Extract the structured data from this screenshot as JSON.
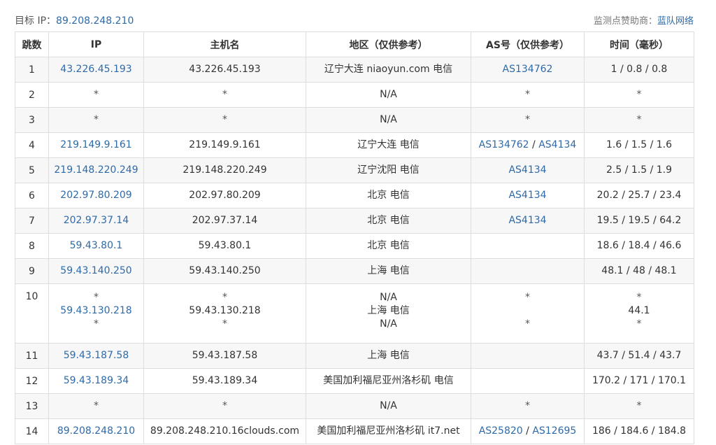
{
  "header": {
    "target_label": "目标 IP：",
    "target_ip": "89.208.248.210",
    "sponsor_label": "监测点赞助商：",
    "sponsor_name": "蓝队网络"
  },
  "table": {
    "columns": [
      "跳数",
      "IP",
      "主机名",
      "地区（仅供参考）",
      "AS号（仅供参考）",
      "时间（毫秒）"
    ],
    "rows": [
      {
        "hop": "1",
        "ip": [
          "43.226.45.193"
        ],
        "host": [
          "43.226.45.193"
        ],
        "region": [
          "辽宁大连 niaoyun.com 电信"
        ],
        "as": [
          [
            "AS134762"
          ]
        ],
        "time": [
          "1 / 0.8 / 0.8"
        ]
      },
      {
        "hop": "2",
        "ip": [
          "*"
        ],
        "host": [
          "*"
        ],
        "region": [
          "N/A"
        ],
        "as": [
          [
            "*"
          ]
        ],
        "time": [
          "*"
        ]
      },
      {
        "hop": "3",
        "ip": [
          "*"
        ],
        "host": [
          "*"
        ],
        "region": [
          "N/A"
        ],
        "as": [
          [
            "*"
          ]
        ],
        "time": [
          "*"
        ]
      },
      {
        "hop": "4",
        "ip": [
          "219.149.9.161"
        ],
        "host": [
          "219.149.9.161"
        ],
        "region": [
          "辽宁大连 电信"
        ],
        "as": [
          [
            "AS134762",
            "AS4134"
          ]
        ],
        "time": [
          "1.6 / 1.5 / 1.6"
        ]
      },
      {
        "hop": "5",
        "ip": [
          "219.148.220.249"
        ],
        "host": [
          "219.148.220.249"
        ],
        "region": [
          "辽宁沈阳 电信"
        ],
        "as": [
          [
            "AS4134"
          ]
        ],
        "time": [
          "2.5 / 1.5 / 1.9"
        ]
      },
      {
        "hop": "6",
        "ip": [
          "202.97.80.209"
        ],
        "host": [
          "202.97.80.209"
        ],
        "region": [
          "北京 电信"
        ],
        "as": [
          [
            "AS4134"
          ]
        ],
        "time": [
          "20.2 / 25.7 / 23.4"
        ]
      },
      {
        "hop": "7",
        "ip": [
          "202.97.37.14"
        ],
        "host": [
          "202.97.37.14"
        ],
        "region": [
          "北京 电信"
        ],
        "as": [
          [
            "AS4134"
          ]
        ],
        "time": [
          "19.5 / 19.5 / 64.2"
        ]
      },
      {
        "hop": "8",
        "ip": [
          "59.43.80.1"
        ],
        "host": [
          "59.43.80.1"
        ],
        "region": [
          "北京 电信"
        ],
        "as": [
          []
        ],
        "time": [
          "18.6 / 18.4 / 46.6"
        ]
      },
      {
        "hop": "9",
        "ip": [
          "59.43.140.250"
        ],
        "host": [
          "59.43.140.250"
        ],
        "region": [
          "上海 电信"
        ],
        "as": [
          []
        ],
        "time": [
          "48.1 / 48 / 48.1"
        ]
      },
      {
        "hop": "10",
        "ip": [
          "*",
          "59.43.130.218",
          "*"
        ],
        "host": [
          "*",
          "59.43.130.218",
          "*"
        ],
        "region": [
          "N/A",
          "上海 电信",
          "N/A"
        ],
        "as": [
          [
            "*"
          ],
          [],
          [
            "*"
          ]
        ],
        "time": [
          "*",
          "44.1",
          "*"
        ]
      },
      {
        "hop": "11",
        "ip": [
          "59.43.187.58"
        ],
        "host": [
          "59.43.187.58"
        ],
        "region": [
          "上海 电信"
        ],
        "as": [
          []
        ],
        "time": [
          "43.7 / 51.4 / 43.7"
        ]
      },
      {
        "hop": "12",
        "ip": [
          "59.43.189.34"
        ],
        "host": [
          "59.43.189.34"
        ],
        "region": [
          "美国加利福尼亚州洛杉矶 电信"
        ],
        "as": [
          []
        ],
        "time": [
          "170.2 / 171 / 170.1"
        ]
      },
      {
        "hop": "13",
        "ip": [
          "*"
        ],
        "host": [
          "*"
        ],
        "region": [
          "N/A"
        ],
        "as": [
          [
            "*"
          ]
        ],
        "time": [
          "*"
        ]
      },
      {
        "hop": "14",
        "ip": [
          "89.208.248.210"
        ],
        "host": [
          "89.208.248.210.16clouds.com"
        ],
        "region": [
          "美国加利福尼亚州洛杉矶 it7.net"
        ],
        "as": [
          [
            "AS25820",
            "AS12695"
          ]
        ],
        "time": [
          "186 / 184.6 / 184.8"
        ]
      }
    ]
  },
  "colors": {
    "link": "#2f6aa8",
    "border": "#dddddd",
    "stripe": "#f7f7f7"
  }
}
